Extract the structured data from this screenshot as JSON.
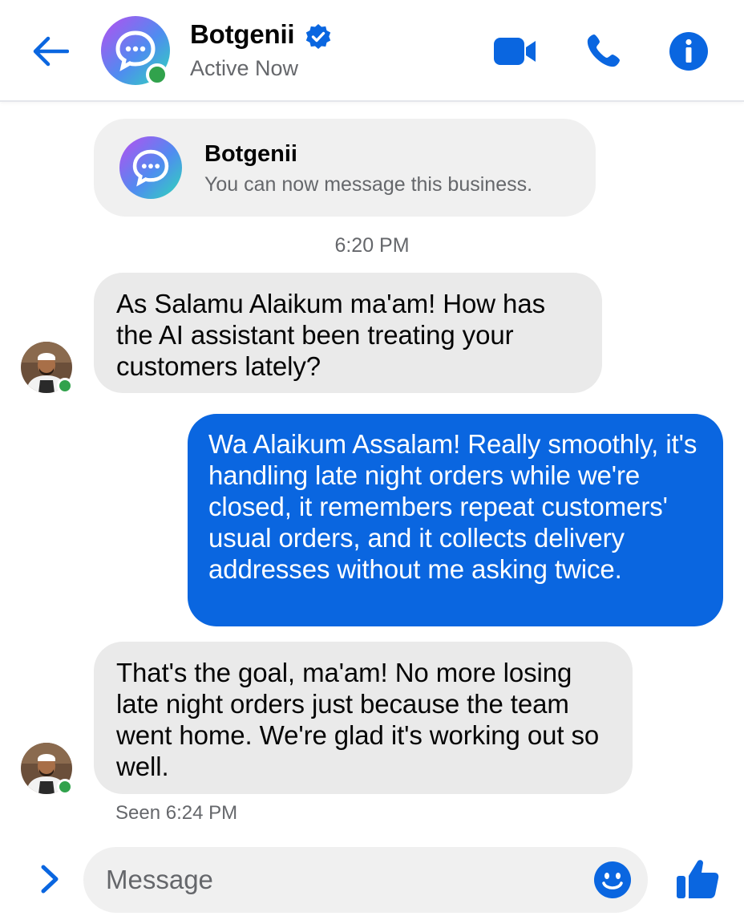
{
  "colors": {
    "accent": "#0a66e0",
    "online": "#31a24c",
    "incoming_bubble": "#eaeaea",
    "muted_text": "#65676b"
  },
  "header": {
    "name": "Botgenii",
    "verified_icon": "verified-badge-icon",
    "status": "Active Now",
    "icons": [
      "back-arrow-icon",
      "video-camera-icon",
      "phone-icon",
      "info-icon"
    ]
  },
  "business_card": {
    "name": "Botgenii",
    "subtitle": "You can now message this business."
  },
  "time_divider": "6:20 PM",
  "messages": [
    {
      "direction": "incoming",
      "text": "As Salamu Alaikum ma'am! How has the AI assistant been treating your customers lately?"
    },
    {
      "direction": "outgoing",
      "text": "Wa Alaikum Assalam! Really smoothly, it's handling late night orders while we're closed, it remembers repeat customers' usual orders, and it collects delivery addresses without me asking twice."
    },
    {
      "direction": "incoming",
      "text": "That's the goal, ma'am! No more losing late night orders just because the team went home. We're glad it's working out so well."
    }
  ],
  "seen_status": "Seen 6:24 PM",
  "composer": {
    "placeholder": "Message",
    "value": "",
    "icons": [
      "chevron-right-icon",
      "emoji-icon",
      "thumbs-up-icon"
    ]
  }
}
